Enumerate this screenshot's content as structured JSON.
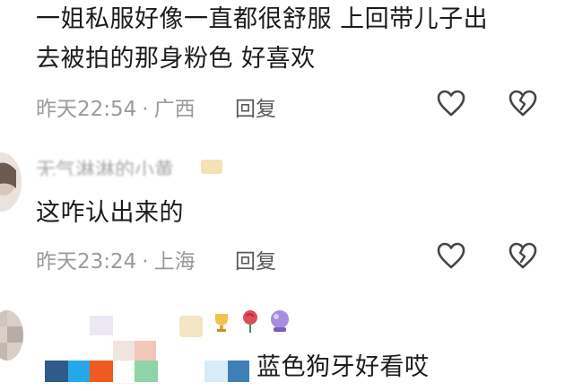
{
  "comments": [
    {
      "text_line1": "一姐私服好像一直都很舒服 上回带儿子出",
      "text_line2": "去被拍的那身粉色 好喜欢",
      "time": "昨天22:54",
      "location": "广西",
      "reply_label": "回复"
    },
    {
      "username": "无气淋淋的小黄",
      "text": "这咋认出来的",
      "time": "昨天23:24",
      "location": "上海",
      "reply_label": "回复"
    },
    {
      "text": "蓝色狗牙好看哎"
    }
  ],
  "separator": "·",
  "icons": {
    "like": "heart-outline-icon",
    "dislike": "broken-heart-icon"
  },
  "colors": {
    "text": "#1b1b1b",
    "meta": "#9a9a9a",
    "icon": "#444444"
  }
}
